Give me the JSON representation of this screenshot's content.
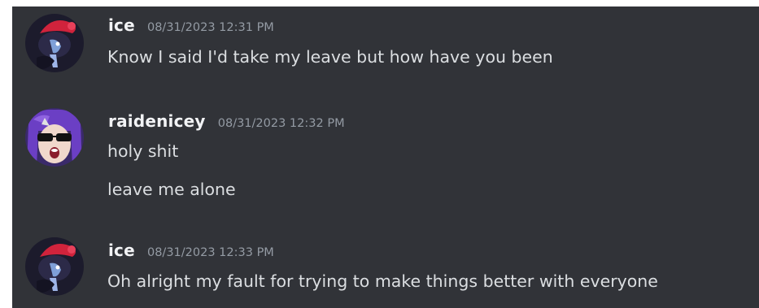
{
  "colors": {
    "background": "#313338",
    "username": "#f2f3f5",
    "timestamp": "#949ba4",
    "message_text": "#dbdee1"
  },
  "messages": [
    {
      "avatar_icon": "red-hat-character-avatar-icon",
      "username": "ice",
      "timestamp": "08/31/2023 12:31 PM",
      "lines": [
        "Know I said I'd take my leave but how have you been"
      ]
    },
    {
      "avatar_icon": "sunglasses-purple-hair-avatar-icon",
      "username": "raidenicey",
      "timestamp": "08/31/2023 12:32 PM",
      "lines": [
        "holy shit",
        "leave me alone"
      ]
    },
    {
      "avatar_icon": "red-hat-character-avatar-icon",
      "username": "ice",
      "timestamp": "08/31/2023 12:33 PM",
      "lines": [
        "Oh alright my fault for trying to make things better with everyone"
      ]
    }
  ]
}
